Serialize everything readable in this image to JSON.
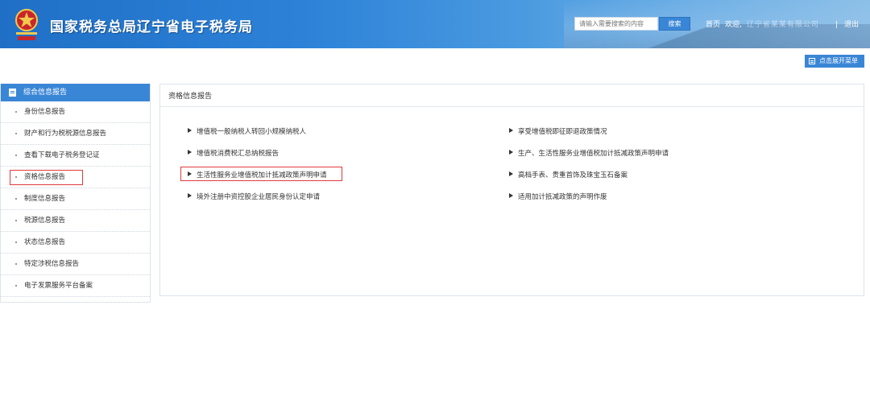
{
  "header": {
    "title": "国家税务总局辽宁省电子税务局",
    "search_placeholder": "请输入需要搜索的内容",
    "search_button": "搜索",
    "home_link": "首页",
    "welcome": "欢迎,",
    "user_blurred": "辽宁省某某有限公司",
    "logout": "退出"
  },
  "toolbar": {
    "expand_menu": "点击展开菜单"
  },
  "sidebar": {
    "heading": "综合信息报告",
    "items": [
      {
        "label": "身份信息报告"
      },
      {
        "label": "财产和行为税税源信息报告"
      },
      {
        "label": "查看下载电子税务登记证"
      },
      {
        "label": "资格信息报告",
        "active": true
      },
      {
        "label": "制度信息报告"
      },
      {
        "label": "税源信息报告"
      },
      {
        "label": "状态信息报告"
      },
      {
        "label": "特定涉税信息报告"
      },
      {
        "label": "电子发票服务平台备案"
      }
    ]
  },
  "main": {
    "panel_title": "资格信息报告",
    "left_items": [
      {
        "label": "增值税一般纳税人转回小规模纳税人"
      },
      {
        "label": "增值税消费税汇总纳税报告"
      },
      {
        "label": "生活性服务业增值税加计抵减政策声明申请",
        "highlighted": true
      },
      {
        "label": "境外注册中资控股企业居民身份认定申请"
      }
    ],
    "right_items": [
      {
        "label": "享受增值税即征即退政策情况"
      },
      {
        "label": "生产、生活性服务业增值税加计抵减政策声明申请"
      },
      {
        "label": "高档手表、贵重首饰及珠宝玉石备案"
      },
      {
        "label": "适用加计抵减政策的声明作废"
      }
    ]
  },
  "colors": {
    "brand_blue": "#3a86d6",
    "highlight_red": "#e0393e"
  }
}
